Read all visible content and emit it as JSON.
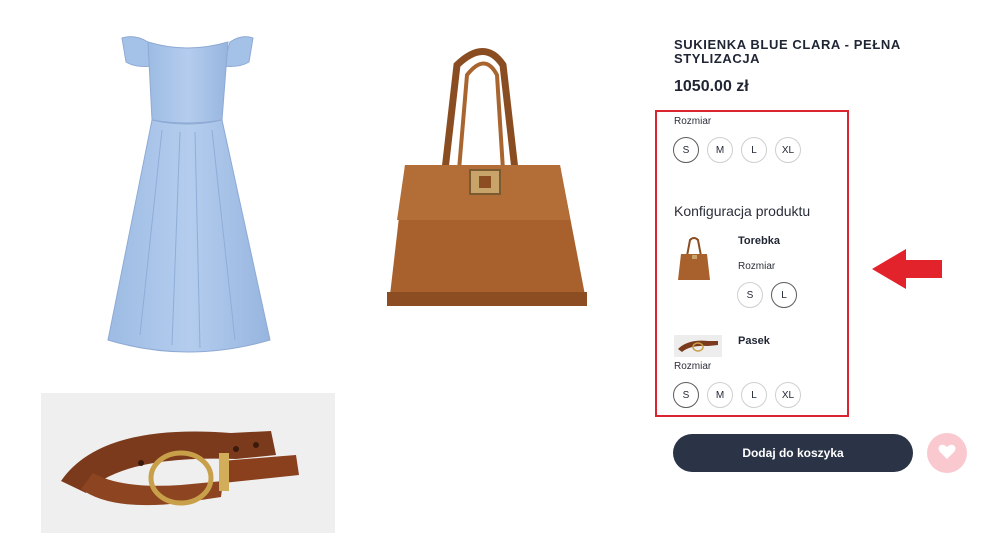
{
  "product": {
    "title": "SUKIENKA BLUE CLARA - PEŁNA STYLIZACJA",
    "price": "1050.00 zł"
  },
  "main_size": {
    "label": "Rozmiar",
    "options": [
      "S",
      "M",
      "L",
      "XL"
    ],
    "selected": "S"
  },
  "configuration": {
    "title": "Konfiguracja produktu",
    "bag": {
      "name": "Torebka",
      "size_label": "Rozmiar",
      "options": [
        "S",
        "L"
      ],
      "selected": "L"
    },
    "belt": {
      "name": "Pasek",
      "size_label": "Rozmiar",
      "options": [
        "S",
        "M",
        "L",
        "XL"
      ],
      "selected": "S"
    }
  },
  "actions": {
    "add_to_cart": "Dodaj do koszyka",
    "favorite_icon": "heart-icon"
  },
  "colors": {
    "primary_button": "#2b3446",
    "favorite_bg": "#f9c9cf",
    "highlight": "#d9252f",
    "dress": "#a9c6ea",
    "leather": "#9a5a2b"
  }
}
